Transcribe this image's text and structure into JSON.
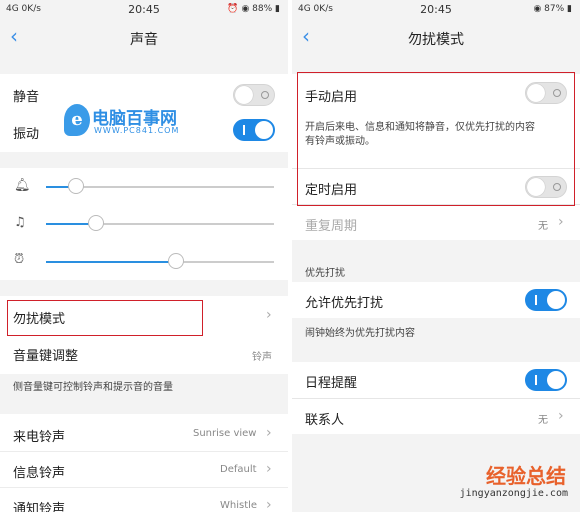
{
  "left": {
    "status": {
      "left": "4G 0K/s",
      "time": "20:45",
      "right": "88%"
    },
    "title": "声音",
    "mute_label": "静音",
    "vibrate_label": "振动",
    "disturb_label": "勿扰模式",
    "volume_key_label": "音量键调整",
    "volume_key_value": "铃声",
    "volume_key_desc": "侧音量键可控制铃声和提示音的音量",
    "ringtone_label": "来电铃声",
    "ringtone_value": "Sunrise view",
    "message_label": "信息铃声",
    "message_value": "Default",
    "notify_label": "通知铃声",
    "notify_value": "Whistle",
    "logo_text": "电脑百事网",
    "logo_url": "WWW.PC841.COM",
    "sliders": [
      0.13,
      0.22,
      0.57
    ],
    "mute_on": false,
    "vibrate_on": true
  },
  "right": {
    "status": {
      "left": "4G 0K/s",
      "time": "20:45",
      "right": "87%"
    },
    "title": "勿扰模式",
    "manual_label": "手动启用",
    "manual_desc_1": "开启后来电、信息和通知将静音，仅优先打扰的内容",
    "manual_desc_2": "有铃声或振动。",
    "timed_label": "定时启用",
    "repeat_label": "重复周期",
    "repeat_value": "无",
    "priority_header": "优先打扰",
    "allow_label": "允许优先打扰",
    "alarm_desc": "闹钟始终为优先打扰内容",
    "schedule_label": "日程提醒",
    "contacts_label": "联系人",
    "contacts_value": "无",
    "watermark_cn": "经验总结",
    "watermark_url": "jingyanzongjie.com"
  },
  "colors": {
    "accent": "#1e88e5",
    "highlight": "#d0202a"
  }
}
